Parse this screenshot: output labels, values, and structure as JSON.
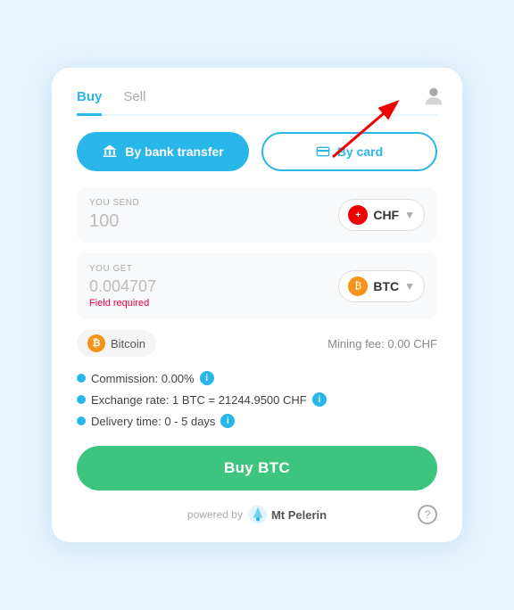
{
  "tabs": {
    "buy": "Buy",
    "sell": "Sell",
    "active": "buy"
  },
  "payment": {
    "bank_label": "By bank transfer",
    "card_label": "By card"
  },
  "send": {
    "label": "YOU SEND",
    "value": "100",
    "currency_code": "CHF",
    "currency_symbol": "+"
  },
  "get": {
    "label": "YOU GET",
    "value": "0.004707",
    "field_required": "Field required",
    "currency_code": "BTC"
  },
  "coin": {
    "name": "Bitcoin",
    "mining_fee": "Mining fee: 0.00 CHF"
  },
  "details": {
    "commission": "Commission: 0.00%",
    "exchange_rate": "Exchange rate: 1 BTC = 21244.9500 CHF",
    "delivery": "Delivery time: 0 - 5 days"
  },
  "buy_button": "Buy BTC",
  "footer": {
    "powered_by": "powered by",
    "brand": "Mt\nPelerin"
  },
  "help": "?"
}
